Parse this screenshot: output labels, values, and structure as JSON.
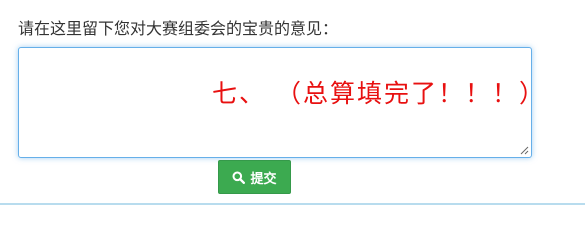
{
  "form": {
    "prompt_label": "请在这里留下您对大赛组委会的宝贵的意见：",
    "feedback_value": "七、 （总算填完了！！！）",
    "submit_label": "提交",
    "submit_icon": "search-icon"
  },
  "colors": {
    "submit_bg": "#3caa50",
    "feedback_text": "#e81010",
    "focus_border": "#66afe9"
  }
}
